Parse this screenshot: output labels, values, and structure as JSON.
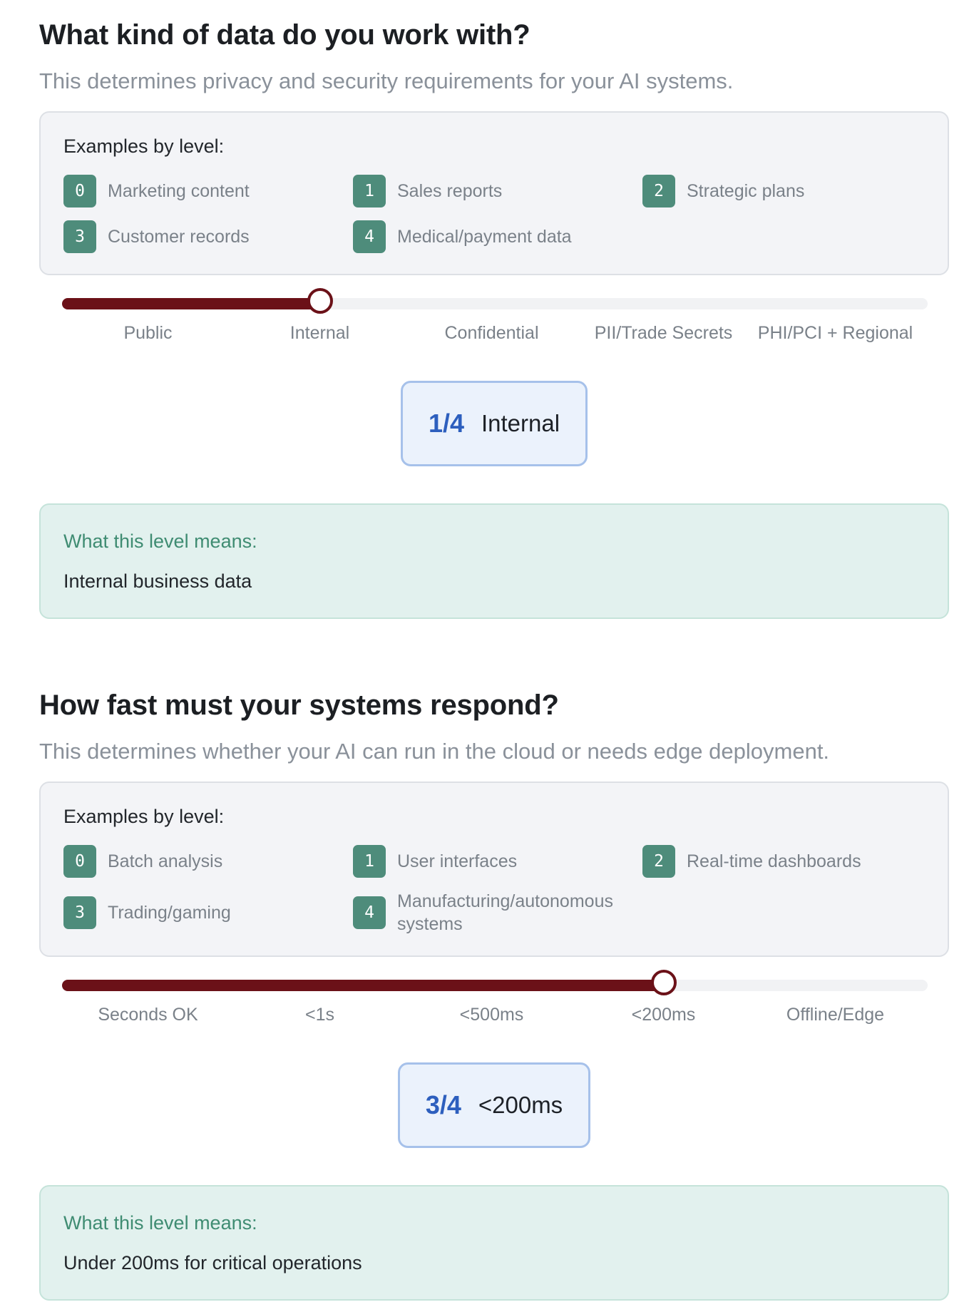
{
  "questions": [
    {
      "title": "What kind of data do you work with?",
      "subtitle": "This determines privacy and security requirements for your AI systems.",
      "examples_title": "Examples by level:",
      "examples": [
        {
          "level": "0",
          "label": "Marketing content"
        },
        {
          "level": "1",
          "label": "Sales reports"
        },
        {
          "level": "2",
          "label": "Strategic plans"
        },
        {
          "level": "3",
          "label": "Customer records"
        },
        {
          "level": "4",
          "label": "Medical/payment data"
        }
      ],
      "slider": {
        "value": 1,
        "max": 4,
        "ticks": [
          "Public",
          "Internal",
          "Confidential",
          "PII/Trade Secrets",
          "PHI/PCI + Regional"
        ]
      },
      "readout": {
        "score": "1/4",
        "label": "Internal"
      },
      "meaning": {
        "title": "What this level means:",
        "text": "Internal business data"
      }
    },
    {
      "title": "How fast must your systems respond?",
      "subtitle": "This determines whether your AI can run in the cloud or needs edge deployment.",
      "examples_title": "Examples by level:",
      "examples": [
        {
          "level": "0",
          "label": "Batch analysis"
        },
        {
          "level": "1",
          "label": "User interfaces"
        },
        {
          "level": "2",
          "label": "Real-time dashboards"
        },
        {
          "level": "3",
          "label": "Trading/gaming"
        },
        {
          "level": "4",
          "label": "Manufacturing/autonomous systems"
        }
      ],
      "slider": {
        "value": 3,
        "max": 4,
        "ticks": [
          "Seconds OK",
          "<1s",
          "<500ms",
          "<200ms",
          "Offline/Edge"
        ]
      },
      "readout": {
        "score": "3/4",
        "label": "<200ms"
      },
      "meaning": {
        "title": "What this level means:",
        "text": "Under 200ms for critical operations"
      }
    }
  ],
  "colors": {
    "slider_fill": "#6b1118",
    "badge": "#4e8c7b",
    "readout_number": "#2d5fbe",
    "meaning_title": "#3f8c72"
  }
}
